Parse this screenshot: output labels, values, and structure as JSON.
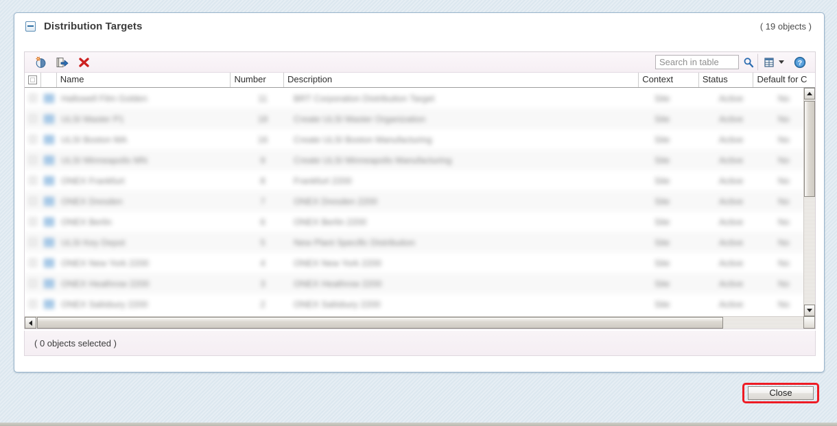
{
  "section": {
    "title": "Distribution Targets",
    "object_count": "( 19 objects )",
    "collapse_icon": "collapse-minus-icon"
  },
  "toolbar": {
    "buttons": [
      {
        "name": "create-object-icon",
        "tooltip": "Create New"
      },
      {
        "name": "export-object-icon",
        "tooltip": "Export"
      },
      {
        "name": "delete-object-icon",
        "tooltip": "Delete"
      }
    ],
    "search": {
      "value": "",
      "placeholder": "Search in table",
      "icon": "magnifier-icon"
    },
    "grid_icon": "table-view-icon",
    "caret_icon": "chevron-down-icon",
    "help_icon": "help-question-icon"
  },
  "table": {
    "columns": [
      {
        "key": "check",
        "label": ""
      },
      {
        "key": "icon",
        "label": ""
      },
      {
        "key": "name",
        "label": "Name"
      },
      {
        "key": "number",
        "label": "Number"
      },
      {
        "key": "desc",
        "label": "Description"
      },
      {
        "key": "context",
        "label": "Context"
      },
      {
        "key": "status",
        "label": "Status"
      },
      {
        "key": "default",
        "label": "Default for C"
      }
    ],
    "rows": [
      {
        "name": "Hallowell Film Golden",
        "number": "11",
        "desc": "BRT Corporation Distribution Target",
        "context": "Site",
        "status": "Active",
        "default": "No"
      },
      {
        "name": "ULSI Master P1",
        "number": "18",
        "desc": "Create ULSI Master Organization",
        "context": "Site",
        "status": "Active",
        "default": "No"
      },
      {
        "name": "ULSI Boston MA",
        "number": "16",
        "desc": "Create ULSI Boston Manufacturing",
        "context": "Site",
        "status": "Active",
        "default": "No"
      },
      {
        "name": "ULSI Minneapolis MN",
        "number": "9",
        "desc": "Create ULSI Minneapolis Manufacturing",
        "context": "Site",
        "status": "Active",
        "default": "No"
      },
      {
        "name": "ONEX Frankfurt",
        "number": "8",
        "desc": "Frankfurt 2200",
        "context": "Site",
        "status": "Active",
        "default": "No"
      },
      {
        "name": "ONEX Dresden",
        "number": "7",
        "desc": "ONEX Dresden 2200",
        "context": "Site",
        "status": "Active",
        "default": "No"
      },
      {
        "name": "ONEX Berlin",
        "number": "6",
        "desc": "ONEX Berlin 2200",
        "context": "Site",
        "status": "Active",
        "default": "No"
      },
      {
        "name": "ULSI Key Depot",
        "number": "5",
        "desc": "New Plant Specific Distribution",
        "context": "Site",
        "status": "Active",
        "default": "No"
      },
      {
        "name": "ONEX New York 2200",
        "number": "4",
        "desc": "ONEX New York 2200",
        "context": "Site",
        "status": "Active",
        "default": "No"
      },
      {
        "name": "ONEX Heathrow 2200",
        "number": "3",
        "desc": "ONEX Heathrow 2200",
        "context": "Site",
        "status": "Active",
        "default": "No"
      },
      {
        "name": "ONEX Salisbury 2200",
        "number": "2",
        "desc": "ONEX Salisbury 2200",
        "context": "Site",
        "status": "Active",
        "default": "No"
      }
    ]
  },
  "status_bar": {
    "text": "( 0 objects selected )"
  },
  "footer": {
    "close_label": "Close",
    "highlight_color": "#ee1b24"
  },
  "scrollbars": {
    "vertical": {
      "up_icon": "scroll-up-arrow-icon",
      "down_icon": "scroll-down-arrow-icon"
    },
    "horizontal": {
      "left_icon": "scroll-left-arrow-icon",
      "right_icon": "scroll-right-arrow-icon"
    }
  }
}
